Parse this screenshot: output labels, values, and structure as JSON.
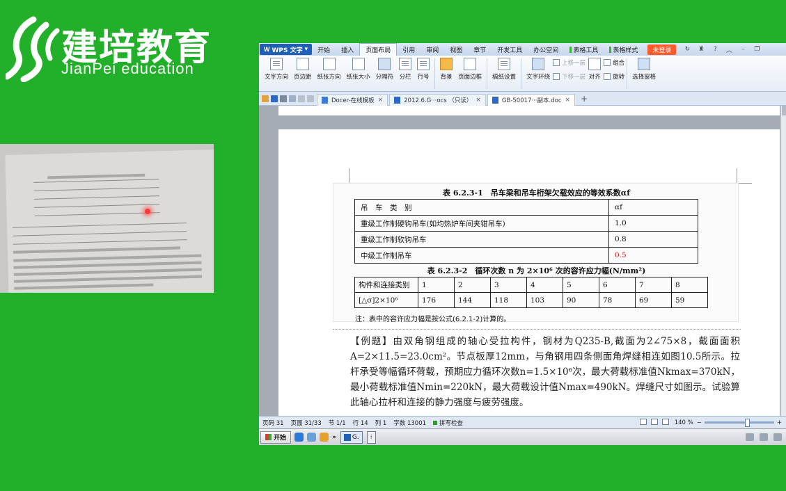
{
  "brand": {
    "name_cn": "建培教育",
    "name_en": "JianPei education"
  },
  "wps": {
    "app_button": "WPS 文字",
    "menu_tabs": [
      "开始",
      "插入",
      "页面布局",
      "引用",
      "审阅",
      "视图",
      "章节",
      "开发工具",
      "办公空间",
      "表格工具",
      "表格样式"
    ],
    "active_tab": "页面布局",
    "login_label": "未登录",
    "ribbon": {
      "text_direction": "文字方向",
      "margins": "页边距",
      "orientation": "纸张方向",
      "paper_size": "纸张大小",
      "separator": "分隔符",
      "columns": "分栏",
      "line_number": "行号",
      "background": "背景",
      "page_border": "页面边框",
      "paper_setting": "稿纸设置",
      "text_wrap": "文字环绕",
      "bring_forward": "上移一层",
      "send_backward": "下移一层",
      "align": "对齐",
      "group": "组合",
      "rotate": "旋转",
      "selection_pane": "选择窗格"
    },
    "doc_tabs": [
      {
        "label": "Docer-在线模板",
        "active": false
      },
      {
        "label": "2012.6.G···ocs （只读）",
        "active": false
      },
      {
        "label": "GB-50017···副本.doc",
        "active": true
      }
    ],
    "doc_tab_close": "×",
    "new_tab": "+"
  },
  "document": {
    "table1": {
      "caption": "表 6.2.3-1　吊车梁和吊车桁架欠载效应的等效系数αf",
      "header": [
        "吊　车　类　别",
        "αf"
      ],
      "rows": [
        [
          "重级工作制硬钩吊车(如均热炉车间夹钳吊车)",
          "1.0"
        ],
        [
          "重级工作制软钩吊车",
          "0.8"
        ],
        [
          "中级工作制吊车",
          "0.5"
        ]
      ]
    },
    "table2": {
      "caption": "表 6.2.3-2　循环次数 n 为 2×10⁶ 次的容许应力幅(N/mm²)",
      "header": [
        "构件和连接类别",
        "1",
        "2",
        "3",
        "4",
        "5",
        "6",
        "7",
        "8"
      ],
      "row_label": "[△σ]2×10⁶",
      "values": [
        "176",
        "144",
        "118",
        "103",
        "90",
        "78",
        "69",
        "59"
      ]
    },
    "note": "注：表中的容许应力幅是按公式(6.2.1-2)计算的。",
    "example_text": "【例题】由双角钢组成的轴心受拉构件，钢材为Q235-B,截面为2∠75×8，截面面积A=2×11.5=23.0cm²。节点板厚12mm，与角钢用四条侧面角焊缝相连如图10.5所示。拉杆承受等幅循环荷载，预期应力循环次数n=1.5×10⁶次，最大荷载标准值Nkmax=370kN，最小荷载标准值Nmin=220kN，最大荷载设计值Nmax=490kN。焊缝尺寸如图示。试验算此轴心拉杆和连接的静力强度与疲劳强度。"
  },
  "status": {
    "page_num": "页码  31",
    "pages": "页面  31/33",
    "section": "节  1/1",
    "row": "行  14",
    "col": "列  1",
    "words": "字数  13001",
    "spell_check": "拼写检查",
    "zoom": "140 %"
  },
  "taskbar": {
    "start_label": "开始",
    "task_label": "G.",
    "more": "»"
  },
  "colors": {
    "background": "#22b02a",
    "wps_blue": "#1f5fb5",
    "login_orange": "#ff5a2a",
    "highlight_red": "#d42020"
  }
}
